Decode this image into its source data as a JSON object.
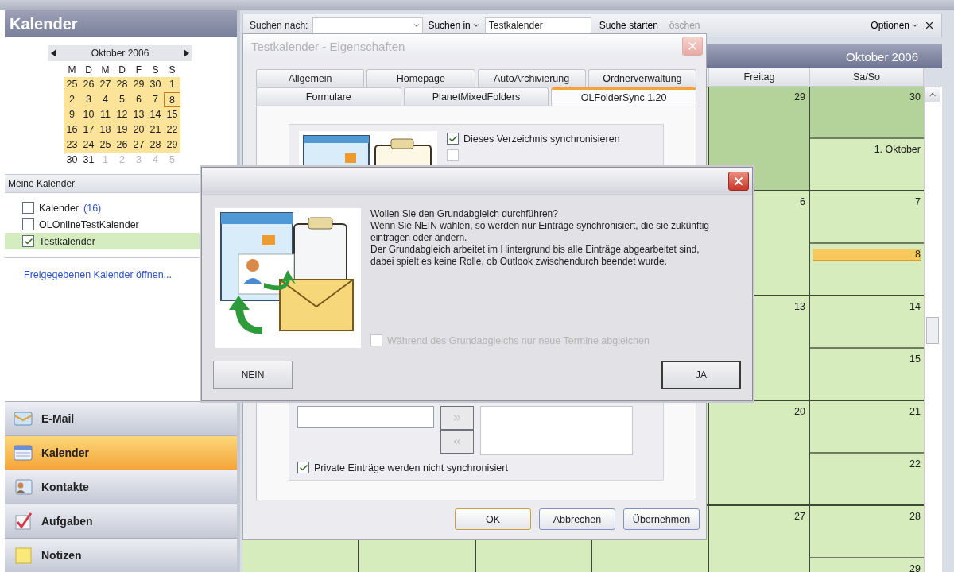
{
  "sidebar": {
    "title": "Kalender",
    "mini_calendar": {
      "month": "Oktober 2006",
      "weekdays": [
        "M",
        "D",
        "M",
        "D",
        "F",
        "S",
        "S"
      ],
      "weeks": [
        [
          {
            "d": "25",
            "kind": "range"
          },
          {
            "d": "26",
            "kind": "range"
          },
          {
            "d": "27",
            "kind": "range"
          },
          {
            "d": "28",
            "kind": "range"
          },
          {
            "d": "29",
            "kind": "range"
          },
          {
            "d": "30",
            "kind": "range"
          },
          {
            "d": "1",
            "kind": "range"
          }
        ],
        [
          {
            "d": "2",
            "kind": "range"
          },
          {
            "d": "3",
            "kind": "range"
          },
          {
            "d": "4",
            "kind": "range"
          },
          {
            "d": "5",
            "kind": "range"
          },
          {
            "d": "6",
            "kind": "range"
          },
          {
            "d": "7",
            "kind": "range"
          },
          {
            "d": "8",
            "kind": "today"
          }
        ],
        [
          {
            "d": "9",
            "kind": "range"
          },
          {
            "d": "10",
            "kind": "range"
          },
          {
            "d": "11",
            "kind": "range"
          },
          {
            "d": "12",
            "kind": "range"
          },
          {
            "d": "13",
            "kind": "range"
          },
          {
            "d": "14",
            "kind": "range"
          },
          {
            "d": "15",
            "kind": "range"
          }
        ],
        [
          {
            "d": "16",
            "kind": "range"
          },
          {
            "d": "17",
            "kind": "range"
          },
          {
            "d": "18",
            "kind": "range"
          },
          {
            "d": "19",
            "kind": "range"
          },
          {
            "d": "20",
            "kind": "range"
          },
          {
            "d": "21",
            "kind": "range"
          },
          {
            "d": "22",
            "kind": "range"
          }
        ],
        [
          {
            "d": "23",
            "kind": "range"
          },
          {
            "d": "24",
            "kind": "range"
          },
          {
            "d": "25",
            "kind": "range"
          },
          {
            "d": "26",
            "kind": "range"
          },
          {
            "d": "27",
            "kind": "range"
          },
          {
            "d": "28",
            "kind": "range"
          },
          {
            "d": "29",
            "kind": "range"
          }
        ],
        [
          {
            "d": "30",
            "kind": "plain"
          },
          {
            "d": "31",
            "kind": "plain"
          },
          {
            "d": "1",
            "kind": "dim"
          },
          {
            "d": "2",
            "kind": "dim"
          },
          {
            "d": "3",
            "kind": "dim"
          },
          {
            "d": "4",
            "kind": "dim"
          },
          {
            "d": "5",
            "kind": "dim"
          }
        ]
      ]
    },
    "my_calendars": {
      "title": "Meine Kalender",
      "items": [
        {
          "label": "Kalender",
          "count": "(16)",
          "checked": false,
          "selected": false
        },
        {
          "label": "OLOnlineTestKalender",
          "checked": false,
          "selected": false
        },
        {
          "label": "Testkalender",
          "checked": true,
          "selected": true
        }
      ]
    },
    "link": "Freigegebenen Kalender öffnen...",
    "nav": [
      {
        "label": "E-Mail",
        "kind": "mail",
        "selected": false
      },
      {
        "label": "Kalender",
        "kind": "calendar",
        "selected": true
      },
      {
        "label": "Kontakte",
        "kind": "contacts",
        "selected": false
      },
      {
        "label": "Aufgaben",
        "kind": "tasks",
        "selected": false
      },
      {
        "label": "Notizen",
        "kind": "notes",
        "selected": false
      }
    ]
  },
  "search_bar": {
    "search_for_label": "Suchen nach:",
    "search_in_label": "Suchen in",
    "scope_value": "Testkalender",
    "start_label": "Suche starten",
    "clear_label": "öschen",
    "options_label": "Optionen"
  },
  "calendar": {
    "month": "Oktober 2006",
    "columns": [
      "Freitag",
      "Sa/So"
    ],
    "weeks": [
      {
        "friday": {
          "date": "29",
          "kind": "prev"
        },
        "saturday": {
          "date": "30",
          "kind": "prev"
        },
        "sunday": {
          "date": "1. Oktober",
          "kind": "cur"
        }
      },
      {
        "friday": {
          "date": "6",
          "kind": "cur"
        },
        "saturday": {
          "date": "7",
          "kind": "cur"
        },
        "sunday": {
          "date": "8",
          "kind": "today"
        }
      },
      {
        "friday": {
          "date": "13",
          "kind": "cur"
        },
        "saturday": {
          "date": "14",
          "kind": "cur"
        },
        "sunday": {
          "date": "15",
          "kind": "cur"
        }
      },
      {
        "friday": {
          "date": "20",
          "kind": "cur"
        },
        "saturday": {
          "date": "21",
          "kind": "cur"
        },
        "sunday": {
          "date": "22",
          "kind": "cur"
        }
      },
      {
        "friday": {
          "date": "27",
          "kind": "cur"
        },
        "saturday": {
          "date": "28",
          "kind": "cur"
        },
        "sunday": {
          "date": "29",
          "kind": "cur"
        }
      }
    ]
  },
  "properties_dialog": {
    "title": "Testkalender - Eigenschaften",
    "tab_rows": [
      [
        {
          "label": "Allgemein",
          "selected": false
        },
        {
          "label": "Homepage",
          "selected": false
        },
        {
          "label": "AutoArchivierung",
          "selected": false
        },
        {
          "label": "Ordnerverwaltung",
          "selected": false
        }
      ],
      [
        {
          "label": "Formulare",
          "selected": false
        },
        {
          "label": "PlanetMixedFolders",
          "selected": false
        },
        {
          "label": "OLFolderSync 1.20",
          "selected": true
        }
      ]
    ],
    "sync_checkbox": {
      "label": "Dieses Verzeichnis synchronisieren",
      "checked": true
    },
    "second_checkbox": {
      "checked": false,
      "disabled": true
    },
    "private_checkbox": {
      "label": "Private Einträge werden nicht synchronisiert",
      "checked": true
    },
    "buttons": [
      {
        "label": "OK",
        "kind": "default"
      },
      {
        "label": "Abbrechen",
        "kind": "normal"
      },
      {
        "label": "Übernehmen",
        "kind": "normal"
      }
    ]
  },
  "confirm_dialog": {
    "message": "Wollen Sie den Grundabgleich durchführen?\nWenn Sie NEIN wählen, so werden nur Einträge synchronisiert, die sie zukünftig eintragen oder ändern.\nDer Grundabgleich arbeitet im Hintergrund bis alle Einträge abgearbeitet sind,\ndabei spielt es keine Rolle, ob Outlook zwischendurch beendet wurde.",
    "option": {
      "label": "Während des Grundabgleichs nur neue Termine abgleichen",
      "checked": false,
      "disabled": true
    },
    "buttons": [
      {
        "label": "NEIN",
        "kind": "normal"
      },
      {
        "label": "JA",
        "kind": "default"
      }
    ]
  }
}
